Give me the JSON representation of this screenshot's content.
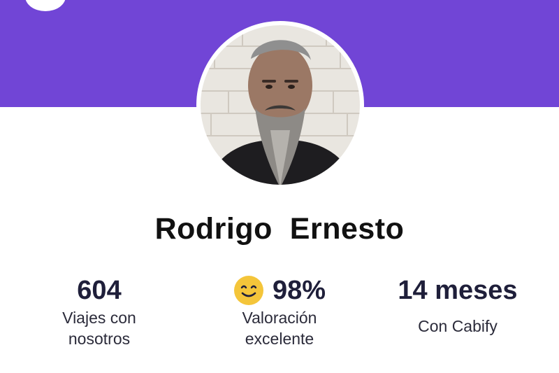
{
  "header": {
    "accent_color": "#7145d6",
    "back_button_icon": "back-icon"
  },
  "profile": {
    "name": "Rodrigo  Ernesto",
    "avatar_icon": "driver-photo"
  },
  "stats": [
    {
      "value": "604",
      "label_line1": "Viajes con",
      "label_line2": "nosotros"
    },
    {
      "value": "98%",
      "icon": "smiley-face-icon",
      "label_line1": "Valoración",
      "label_line2": "excelente"
    },
    {
      "value": "14 meses",
      "label_line1": "Con Cabify",
      "label_line2": ""
    }
  ]
}
